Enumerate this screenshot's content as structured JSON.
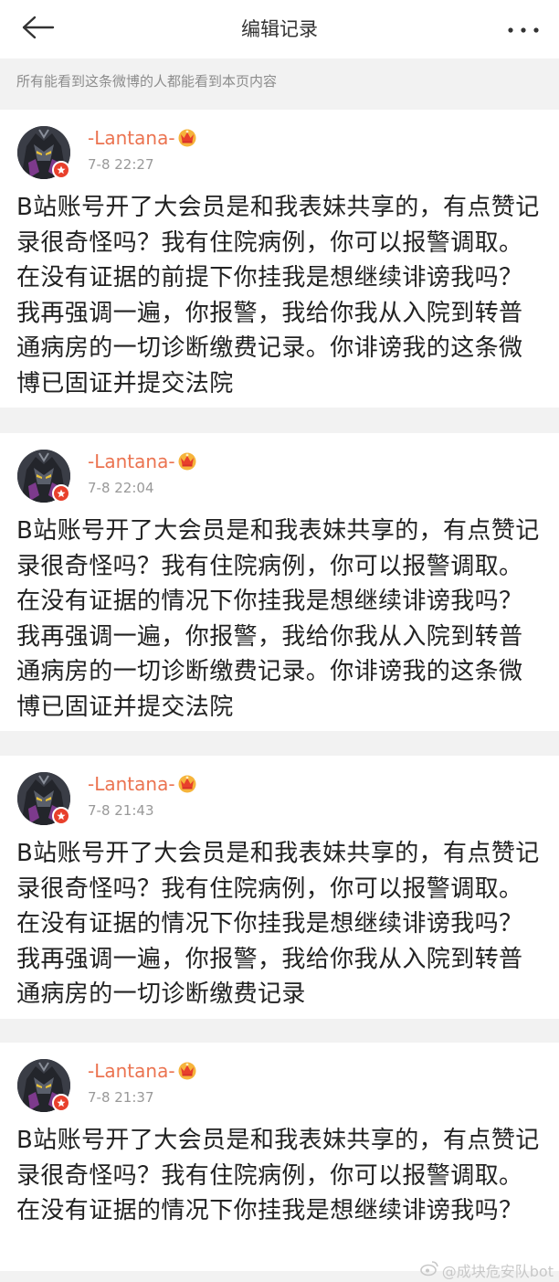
{
  "header": {
    "title": "编辑记录",
    "back_icon": "back-arrow-icon",
    "more_icon": "more-dots-icon"
  },
  "notice": "所有能看到这条微博的人都能看到本页内容",
  "colors": {
    "username": "#eb7350",
    "verified_badge": "#e8402c",
    "background": "#f2f2f2"
  },
  "records": [
    {
      "user": "-Lantana-",
      "time": "7-8 22:27",
      "text": "B站账号开了大会员是和我表妹共享的，有点赞记录很奇怪吗？我有住院病例，你可以报警调取。在没有证据的前提下你挂我是想继续诽谤我吗？我再强调一遍，你报警，我给你我从入院到转普通病房的一切诊断缴费记录。你诽谤我的这条微博已固证并提交法院"
    },
    {
      "user": "-Lantana-",
      "time": "7-8 22:04",
      "text": "B站账号开了大会员是和我表妹共享的，有点赞记录很奇怪吗？我有住院病例，你可以报警调取。在没有证据的情况下你挂我是想继续诽谤我吗？我再强调一遍，你报警，我给你我从入院到转普通病房的一切诊断缴费记录。你诽谤我的这条微博已固证并提交法院"
    },
    {
      "user": "-Lantana-",
      "time": "7-8 21:43",
      "text": "B站账号开了大会员是和我表妹共享的，有点赞记录很奇怪吗？我有住院病例，你可以报警调取。在没有证据的情况下你挂我是想继续诽谤我吗？我再强调一遍，你报警，我给你我从入院到转普通病房的一切诊断缴费记录"
    },
    {
      "user": "-Lantana-",
      "time": "7-8 21:37",
      "text": "B站账号开了大会员是和我表妹共享的，有点赞记录很奇怪吗？我有住院病例，你可以报警调取。在没有证据的情况下你挂我是想继续诽谤我吗？"
    }
  ],
  "watermark": "@成块危安队bot"
}
